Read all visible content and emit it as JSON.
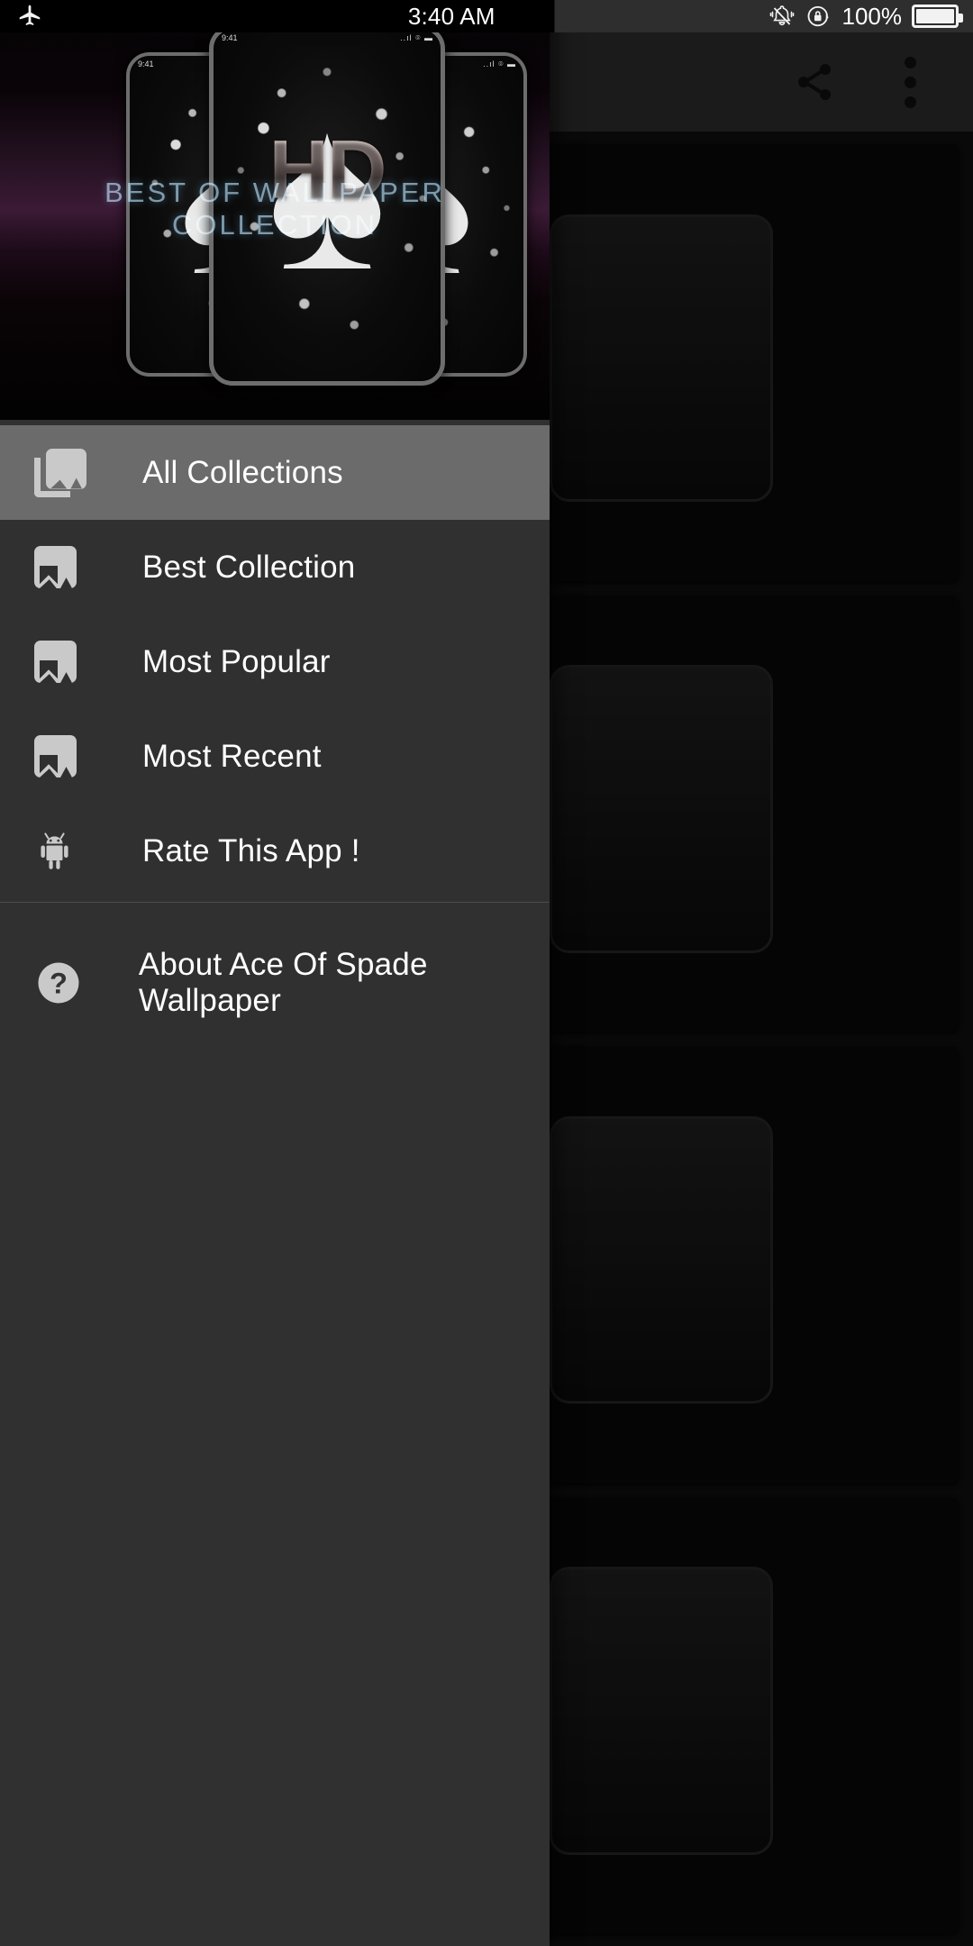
{
  "status_bar": {
    "airplane_icon": "airplane-mode-icon",
    "clock": "3:40 AM",
    "vibrate_icon": "vibrate-silent-icon",
    "rotation_lock_icon": "rotation-lock-icon",
    "battery_text": "100%",
    "battery_icon": "battery-full-icon"
  },
  "toolbar": {
    "share_icon": "share-icon",
    "overflow_icon": "more-vertical-icon"
  },
  "drawer": {
    "header": {
      "title": "BEST OF WALLPAPER COLLECTION",
      "badge": "HD",
      "phone_time": "9:41",
      "phone_status": "..ıl ⌾ ▬"
    },
    "items": [
      {
        "label": "All Collections",
        "icon": "collections-icon",
        "active": true
      },
      {
        "label": "Best Collection",
        "icon": "image-icon",
        "active": false
      },
      {
        "label": "Most Popular",
        "icon": "image-icon",
        "active": false
      },
      {
        "label": "Most Recent",
        "icon": "image-icon",
        "active": false
      },
      {
        "label": "Rate This App !",
        "icon": "android-robot-icon",
        "active": false
      }
    ],
    "footer_items": [
      {
        "label": "About Ace Of Spade Wallpaper",
        "icon": "help-circle-icon",
        "active": false
      }
    ]
  },
  "colors": {
    "drawer_background": "#303030",
    "drawer_selected": "#6b6b6b",
    "toolbar_background": "#3c3c3c",
    "icon_tint": "#c9c9c9",
    "text_primary": "#ffffff",
    "header_title": "#96b9cd",
    "status_bar_right": "#2e2e2e"
  }
}
